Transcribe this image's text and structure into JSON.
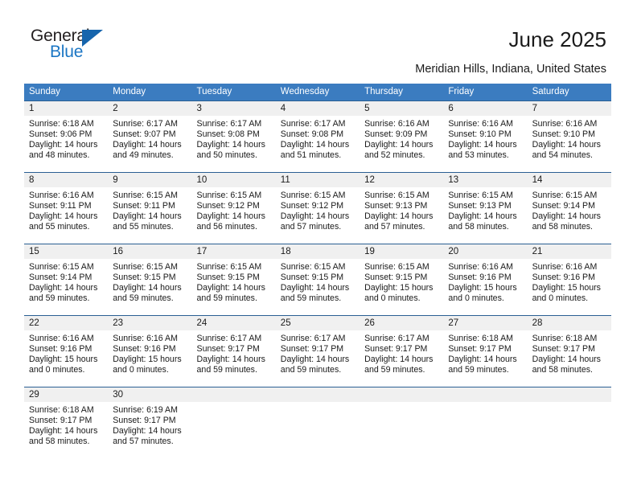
{
  "brand": {
    "word_one": "General",
    "word_two": "Blue",
    "triangle_color": "#1665ad",
    "blue_text_color": "#1b76c4"
  },
  "header": {
    "title": "June 2025",
    "subtitle": "Meridian Hills, Indiana, United States",
    "header_bg": "#3b7cc0",
    "band_bg": "#f0f0f0",
    "rule_color": "#2a5f93"
  },
  "weekdays": [
    "Sunday",
    "Monday",
    "Tuesday",
    "Wednesday",
    "Thursday",
    "Friday",
    "Saturday"
  ],
  "weeks": [
    {
      "days": [
        {
          "num": "1",
          "sunrise": "Sunrise: 6:18 AM",
          "sunset": "Sunset: 9:06 PM",
          "daylight_a": "Daylight: 14 hours",
          "daylight_b": "and 48 minutes."
        },
        {
          "num": "2",
          "sunrise": "Sunrise: 6:17 AM",
          "sunset": "Sunset: 9:07 PM",
          "daylight_a": "Daylight: 14 hours",
          "daylight_b": "and 49 minutes."
        },
        {
          "num": "3",
          "sunrise": "Sunrise: 6:17 AM",
          "sunset": "Sunset: 9:08 PM",
          "daylight_a": "Daylight: 14 hours",
          "daylight_b": "and 50 minutes."
        },
        {
          "num": "4",
          "sunrise": "Sunrise: 6:17 AM",
          "sunset": "Sunset: 9:08 PM",
          "daylight_a": "Daylight: 14 hours",
          "daylight_b": "and 51 minutes."
        },
        {
          "num": "5",
          "sunrise": "Sunrise: 6:16 AM",
          "sunset": "Sunset: 9:09 PM",
          "daylight_a": "Daylight: 14 hours",
          "daylight_b": "and 52 minutes."
        },
        {
          "num": "6",
          "sunrise": "Sunrise: 6:16 AM",
          "sunset": "Sunset: 9:10 PM",
          "daylight_a": "Daylight: 14 hours",
          "daylight_b": "and 53 minutes."
        },
        {
          "num": "7",
          "sunrise": "Sunrise: 6:16 AM",
          "sunset": "Sunset: 9:10 PM",
          "daylight_a": "Daylight: 14 hours",
          "daylight_b": "and 54 minutes."
        }
      ]
    },
    {
      "days": [
        {
          "num": "8",
          "sunrise": "Sunrise: 6:16 AM",
          "sunset": "Sunset: 9:11 PM",
          "daylight_a": "Daylight: 14 hours",
          "daylight_b": "and 55 minutes."
        },
        {
          "num": "9",
          "sunrise": "Sunrise: 6:15 AM",
          "sunset": "Sunset: 9:11 PM",
          "daylight_a": "Daylight: 14 hours",
          "daylight_b": "and 55 minutes."
        },
        {
          "num": "10",
          "sunrise": "Sunrise: 6:15 AM",
          "sunset": "Sunset: 9:12 PM",
          "daylight_a": "Daylight: 14 hours",
          "daylight_b": "and 56 minutes."
        },
        {
          "num": "11",
          "sunrise": "Sunrise: 6:15 AM",
          "sunset": "Sunset: 9:12 PM",
          "daylight_a": "Daylight: 14 hours",
          "daylight_b": "and 57 minutes."
        },
        {
          "num": "12",
          "sunrise": "Sunrise: 6:15 AM",
          "sunset": "Sunset: 9:13 PM",
          "daylight_a": "Daylight: 14 hours",
          "daylight_b": "and 57 minutes."
        },
        {
          "num": "13",
          "sunrise": "Sunrise: 6:15 AM",
          "sunset": "Sunset: 9:13 PM",
          "daylight_a": "Daylight: 14 hours",
          "daylight_b": "and 58 minutes."
        },
        {
          "num": "14",
          "sunrise": "Sunrise: 6:15 AM",
          "sunset": "Sunset: 9:14 PM",
          "daylight_a": "Daylight: 14 hours",
          "daylight_b": "and 58 minutes."
        }
      ]
    },
    {
      "days": [
        {
          "num": "15",
          "sunrise": "Sunrise: 6:15 AM",
          "sunset": "Sunset: 9:14 PM",
          "daylight_a": "Daylight: 14 hours",
          "daylight_b": "and 59 minutes."
        },
        {
          "num": "16",
          "sunrise": "Sunrise: 6:15 AM",
          "sunset": "Sunset: 9:15 PM",
          "daylight_a": "Daylight: 14 hours",
          "daylight_b": "and 59 minutes."
        },
        {
          "num": "17",
          "sunrise": "Sunrise: 6:15 AM",
          "sunset": "Sunset: 9:15 PM",
          "daylight_a": "Daylight: 14 hours",
          "daylight_b": "and 59 minutes."
        },
        {
          "num": "18",
          "sunrise": "Sunrise: 6:15 AM",
          "sunset": "Sunset: 9:15 PM",
          "daylight_a": "Daylight: 14 hours",
          "daylight_b": "and 59 minutes."
        },
        {
          "num": "19",
          "sunrise": "Sunrise: 6:15 AM",
          "sunset": "Sunset: 9:15 PM",
          "daylight_a": "Daylight: 15 hours",
          "daylight_b": "and 0 minutes."
        },
        {
          "num": "20",
          "sunrise": "Sunrise: 6:16 AM",
          "sunset": "Sunset: 9:16 PM",
          "daylight_a": "Daylight: 15 hours",
          "daylight_b": "and 0 minutes."
        },
        {
          "num": "21",
          "sunrise": "Sunrise: 6:16 AM",
          "sunset": "Sunset: 9:16 PM",
          "daylight_a": "Daylight: 15 hours",
          "daylight_b": "and 0 minutes."
        }
      ]
    },
    {
      "days": [
        {
          "num": "22",
          "sunrise": "Sunrise: 6:16 AM",
          "sunset": "Sunset: 9:16 PM",
          "daylight_a": "Daylight: 15 hours",
          "daylight_b": "and 0 minutes."
        },
        {
          "num": "23",
          "sunrise": "Sunrise: 6:16 AM",
          "sunset": "Sunset: 9:16 PM",
          "daylight_a": "Daylight: 15 hours",
          "daylight_b": "and 0 minutes."
        },
        {
          "num": "24",
          "sunrise": "Sunrise: 6:17 AM",
          "sunset": "Sunset: 9:17 PM",
          "daylight_a": "Daylight: 14 hours",
          "daylight_b": "and 59 minutes."
        },
        {
          "num": "25",
          "sunrise": "Sunrise: 6:17 AM",
          "sunset": "Sunset: 9:17 PM",
          "daylight_a": "Daylight: 14 hours",
          "daylight_b": "and 59 minutes."
        },
        {
          "num": "26",
          "sunrise": "Sunrise: 6:17 AM",
          "sunset": "Sunset: 9:17 PM",
          "daylight_a": "Daylight: 14 hours",
          "daylight_b": "and 59 minutes."
        },
        {
          "num": "27",
          "sunrise": "Sunrise: 6:18 AM",
          "sunset": "Sunset: 9:17 PM",
          "daylight_a": "Daylight: 14 hours",
          "daylight_b": "and 59 minutes."
        },
        {
          "num": "28",
          "sunrise": "Sunrise: 6:18 AM",
          "sunset": "Sunset: 9:17 PM",
          "daylight_a": "Daylight: 14 hours",
          "daylight_b": "and 58 minutes."
        }
      ]
    },
    {
      "days": [
        {
          "num": "29",
          "sunrise": "Sunrise: 6:18 AM",
          "sunset": "Sunset: 9:17 PM",
          "daylight_a": "Daylight: 14 hours",
          "daylight_b": "and 58 minutes."
        },
        {
          "num": "30",
          "sunrise": "Sunrise: 6:19 AM",
          "sunset": "Sunset: 9:17 PM",
          "daylight_a": "Daylight: 14 hours",
          "daylight_b": "and 57 minutes."
        },
        {
          "num": "",
          "sunrise": "",
          "sunset": "",
          "daylight_a": "",
          "daylight_b": ""
        },
        {
          "num": "",
          "sunrise": "",
          "sunset": "",
          "daylight_a": "",
          "daylight_b": ""
        },
        {
          "num": "",
          "sunrise": "",
          "sunset": "",
          "daylight_a": "",
          "daylight_b": ""
        },
        {
          "num": "",
          "sunrise": "",
          "sunset": "",
          "daylight_a": "",
          "daylight_b": ""
        },
        {
          "num": "",
          "sunrise": "",
          "sunset": "",
          "daylight_a": "",
          "daylight_b": ""
        }
      ]
    }
  ]
}
